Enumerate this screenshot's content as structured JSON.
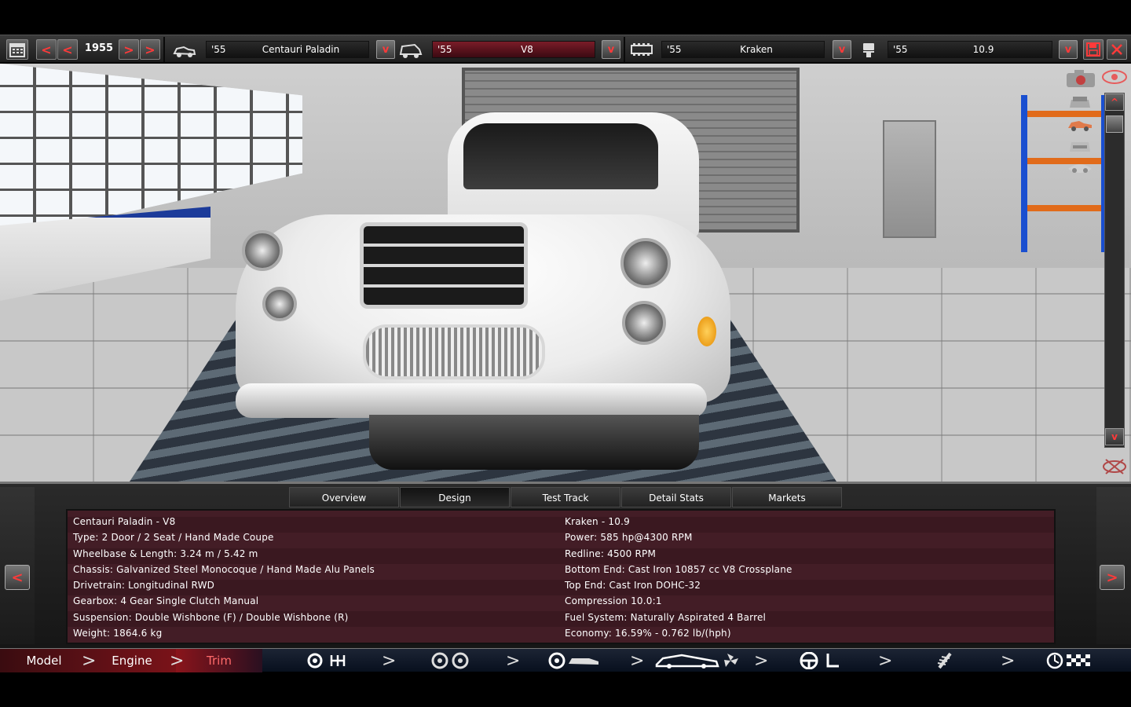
{
  "toolbar": {
    "year": "1955",
    "model": {
      "year": "'55",
      "name": "Centauri Paladin"
    },
    "engine": {
      "year": "'55",
      "name": "V8"
    },
    "engine_family": {
      "year": "'55",
      "name": "Kraken"
    },
    "trim": {
      "year": "'55",
      "name": "10.9"
    },
    "prev_label": "<",
    "next_label": ">",
    "dropdown_label": "v"
  },
  "viewport": {
    "scroll_up_label": "^",
    "scroll_down_label": "v"
  },
  "tabs": [
    {
      "label": "Overview",
      "active": false
    },
    {
      "label": "Design",
      "active": true
    },
    {
      "label": "Test Track",
      "active": false
    },
    {
      "label": "Detail Stats",
      "active": false
    },
    {
      "label": "Markets",
      "active": false
    }
  ],
  "info": {
    "left": [
      "Centauri Paladin - V8",
      "Type: 2 Door / 2 Seat / Hand Made Coupe",
      "Wheelbase & Length: 3.24 m / 5.42 m",
      "Chassis: Galvanized Steel Monocoque / Hand Made Alu Panels",
      "Drivetrain: Longitudinal RWD",
      "Gearbox: 4 Gear Single Clutch Manual",
      "Suspension: Double Wishbone (F) / Double Wishbone (R)",
      "Weight: 1864.6 kg"
    ],
    "right": [
      "Kraken - 10.9",
      "Power: 585 hp@4300 RPM",
      "Redline: 4500 RPM",
      "Bottom End: Cast Iron 10857 cc V8 Crossplane",
      "Top End: Cast Iron DOHC-32",
      "Compression 10.0:1",
      "Fuel System: Naturally Aspirated 4 Barrel",
      "Economy: 16.59% - 0.762 lb/(hph)"
    ],
    "prev_label": "<",
    "next_label": ">"
  },
  "nav": {
    "model": "Model",
    "engine": "Engine",
    "trim": "Trim",
    "chevron": ">"
  },
  "colors": {
    "accent_red": "#ff3a3a",
    "info_bg": "#431d26",
    "nav_bg": "#08101e"
  }
}
